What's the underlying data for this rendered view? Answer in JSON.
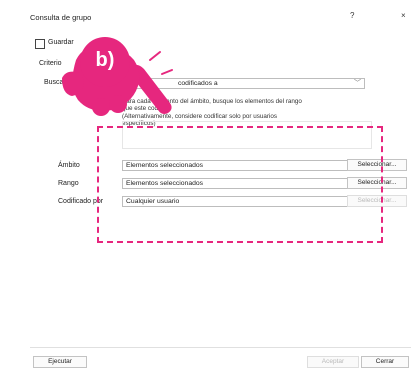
{
  "window": {
    "title": "Consulta de grupo",
    "help_glyph": "?",
    "close_glyph": "×"
  },
  "checkbox_label": "Guardar",
  "criteria_label": "Criterio",
  "buscar_label": "Buscar",
  "buscar_select": "codificados a",
  "description": [
    "Para cada elemento del ámbito, busque los elementos del rango",
    "que este codifica.",
    "(Alternativamente, considere codificar solo por usuarios",
    "específicos)"
  ],
  "rows": [
    {
      "label": "Ámbito",
      "value": "Elementos seleccionados",
      "button": "Seleccionar..."
    },
    {
      "label": "Rango",
      "value": "Elementos seleccionados",
      "button": "Seleccionar..."
    },
    {
      "label": "Codificado por",
      "value": "Cualquier usuario",
      "button": "Seleccionar..."
    }
  ],
  "footer": {
    "run": "Ejecutar",
    "accept": "Aceptar",
    "close": "Cerrar"
  },
  "annotation": {
    "badge": "b)",
    "color": "#e6277e"
  }
}
